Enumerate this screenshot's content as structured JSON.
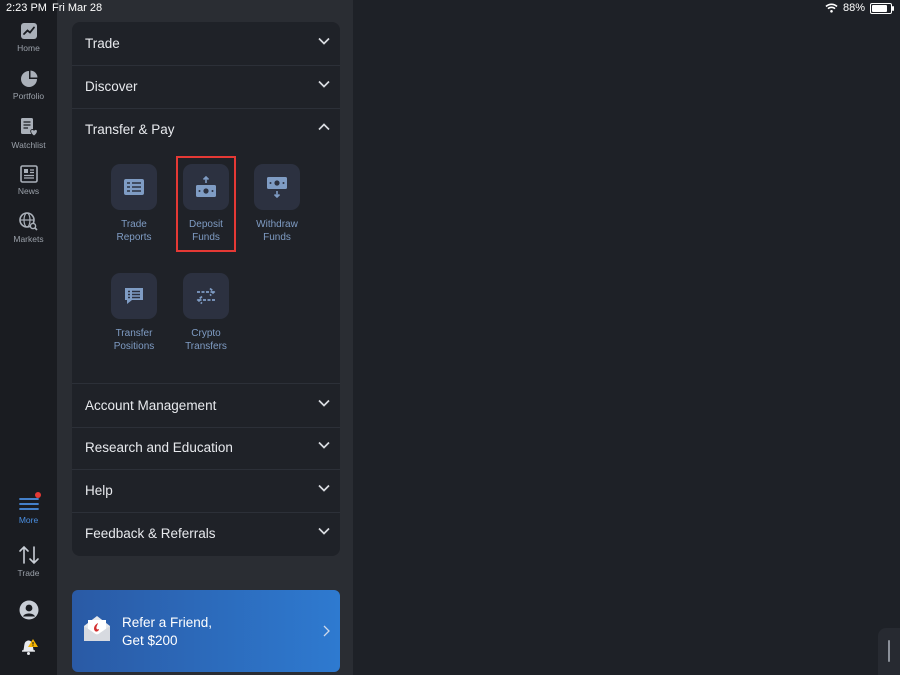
{
  "status_bar": {
    "time": "2:23 PM",
    "date": "Fri Mar 28",
    "battery": "88%"
  },
  "nav_rail": {
    "top_items": [
      {
        "label": "Home",
        "icon": "chart-line-icon"
      },
      {
        "label": "Portfolio",
        "icon": "pie-chart-icon"
      },
      {
        "label": "Watchlist",
        "icon": "watchlist-heart-icon"
      },
      {
        "label": "News",
        "icon": "newspaper-icon"
      },
      {
        "label": "Markets",
        "icon": "globe-search-icon"
      }
    ],
    "bottom_items": [
      {
        "label": "More",
        "icon": "hamburger-menu-icon",
        "active": true,
        "has_notification_dot": true
      },
      {
        "label": "Trade",
        "icon": "up-down-arrows-icon"
      },
      {
        "label": "",
        "icon": "user-avatar-icon"
      },
      {
        "label": "",
        "icon": "bell-alert-icon"
      }
    ]
  },
  "menu": {
    "sections": [
      {
        "label": "Trade",
        "expanded": false
      },
      {
        "label": "Discover",
        "expanded": false
      },
      {
        "label": "Transfer & Pay",
        "expanded": true
      },
      {
        "label": "Account Management",
        "expanded": false
      },
      {
        "label": "Research and Education",
        "expanded": false
      },
      {
        "label": "Help",
        "expanded": false
      },
      {
        "label": "Feedback & Referrals",
        "expanded": false
      }
    ],
    "transfer_tiles": [
      {
        "line1": "Trade",
        "line2": "Reports",
        "icon": "trade-reports-icon"
      },
      {
        "line1": "Deposit",
        "line2": "Funds",
        "icon": "deposit-funds-icon",
        "highlighted": true
      },
      {
        "line1": "Withdraw",
        "line2": "Funds",
        "icon": "withdraw-funds-icon"
      },
      {
        "line1": "Transfer",
        "line2": "Positions",
        "icon": "transfer-positions-icon"
      },
      {
        "line1": "Crypto",
        "line2": "Transfers",
        "icon": "crypto-transfers-icon"
      }
    ]
  },
  "promo": {
    "line1": "Refer a Friend,",
    "line2": "Get $200",
    "icon": "envelope-gift-icon"
  },
  "colors": {
    "accent": "#4a8fe2",
    "highlight": "#e53935",
    "promo_start": "#2a5aa5",
    "promo_end": "#2e7ad0"
  }
}
